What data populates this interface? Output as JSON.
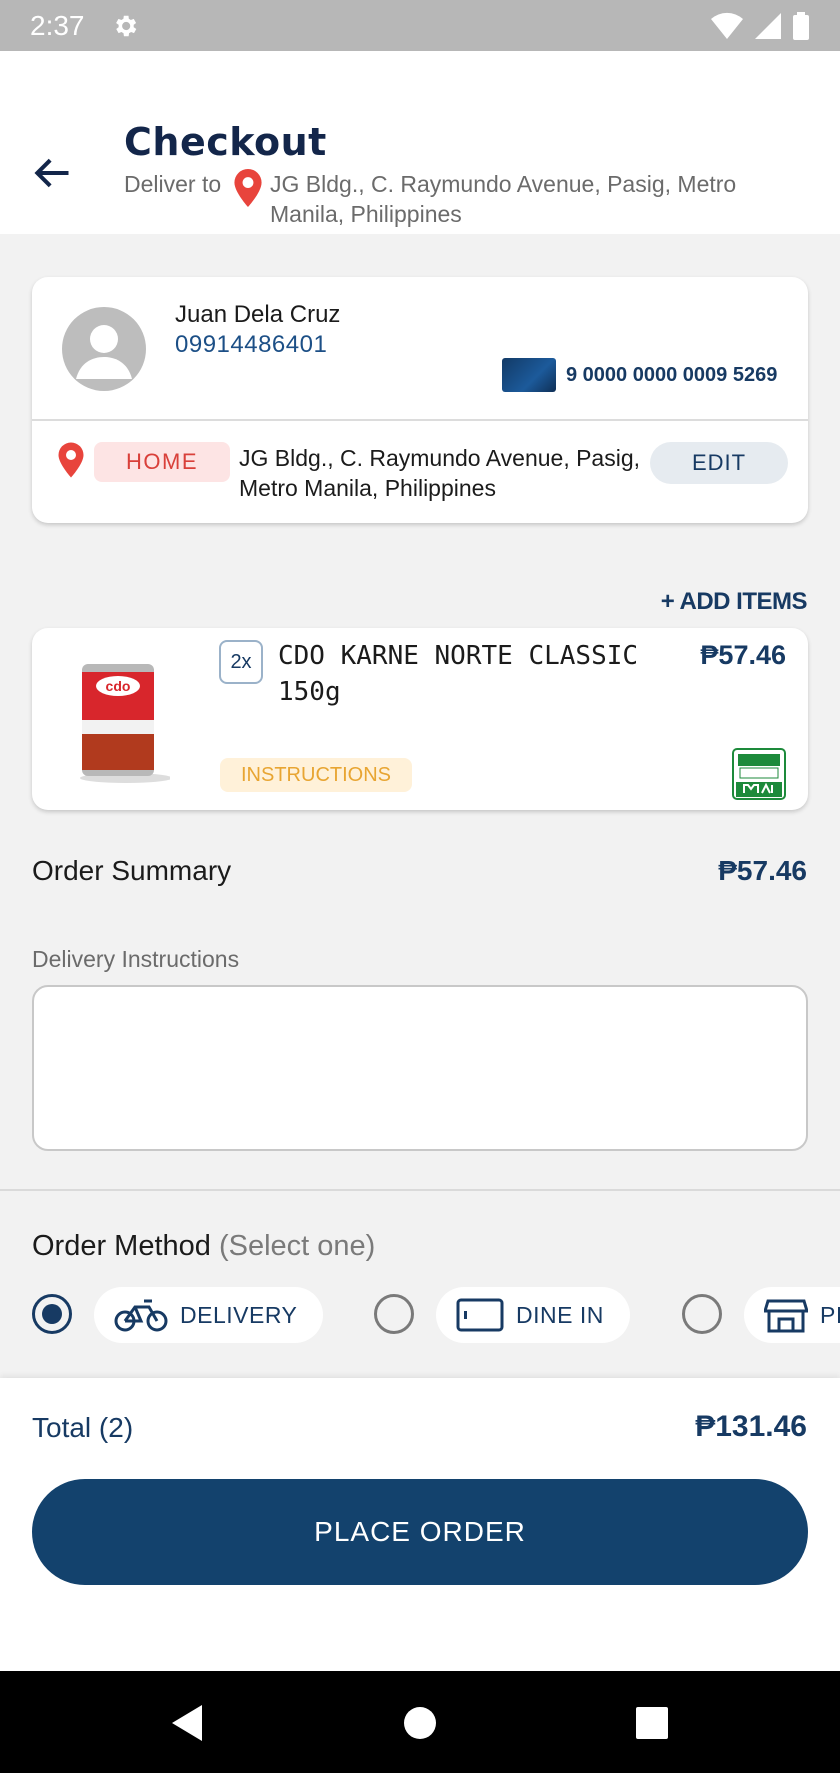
{
  "status_bar": {
    "time": "2:37"
  },
  "header": {
    "title": "Checkout",
    "deliver_label": "Deliver to",
    "deliver_address": "JG Bldg., C. Raymundo Avenue, Pasig, Metro Manila, Philippines"
  },
  "customer": {
    "name": "Juan Dela Cruz",
    "phone": "09914486401",
    "card_number": "9 0000 0000 0009 5269"
  },
  "address": {
    "tag": "HOME",
    "text": "JG Bldg., C. Raymundo Avenue, Pasig, Metro Manila, Philippines",
    "edit_label": "EDIT"
  },
  "cart": {
    "add_items_label": "+ ADD ITEMS",
    "items": [
      {
        "qty": "2x",
        "name": "CDO KARNE NORTE CLASSIC 150g",
        "price": "₱57.46",
        "instructions_label": "INSTRUCTIONS"
      }
    ]
  },
  "order_summary": {
    "label": "Order Summary",
    "value": "₱57.46"
  },
  "delivery_instructions": {
    "label": "Delivery Instructions",
    "value": ""
  },
  "order_method": {
    "label": "Order Method",
    "sublabel": "(Select one)",
    "selected": "DELIVERY",
    "options": [
      {
        "label": "DELIVERY",
        "icon": "bicycle-icon"
      },
      {
        "label": "DINE IN",
        "icon": "table-icon"
      },
      {
        "label": "PI",
        "icon": "store-icon"
      }
    ]
  },
  "footer": {
    "total_label": "Total (2)",
    "total_value": "₱131.46",
    "place_order_label": "PLACE ORDER"
  },
  "colors": {
    "primary": "#13426d",
    "accent_red": "#e8443c",
    "text_navy": "#173a63"
  }
}
